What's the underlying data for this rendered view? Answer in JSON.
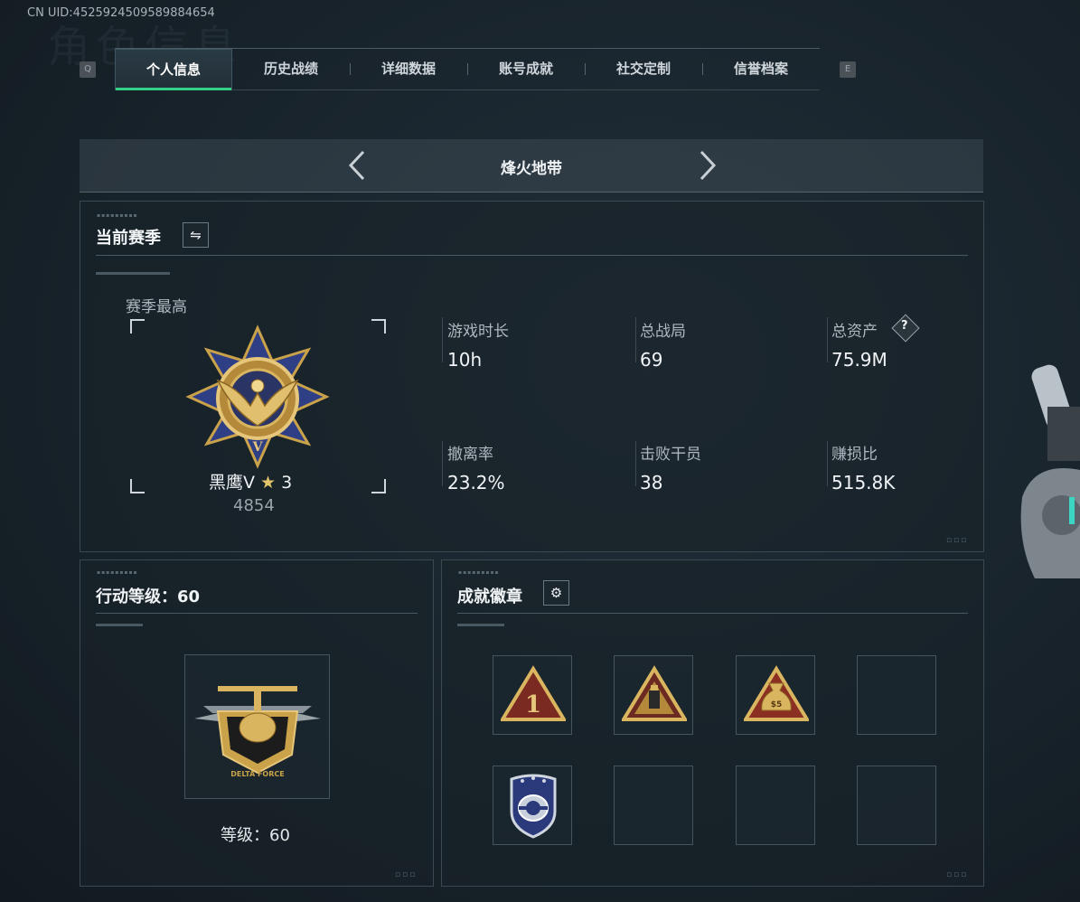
{
  "header": {
    "uid": "CN UID:4525924509589884654",
    "key_left": "Q",
    "key_right": "E"
  },
  "tabs": [
    {
      "label": "个人信息",
      "active": true
    },
    {
      "label": "历史战绩",
      "active": false
    },
    {
      "label": "详细数据",
      "active": false
    },
    {
      "label": "账号成就",
      "active": false
    },
    {
      "label": "社交定制",
      "active": false
    },
    {
      "label": "信誉档案",
      "active": false
    }
  ],
  "mode": {
    "title": "烽火地带",
    "prev_icon": "chevron-left-icon",
    "next_icon": "chevron-right-icon"
  },
  "season": {
    "title": "当前赛季",
    "switch_icon": "swap-icon",
    "best_label": "赛季最高",
    "rank_name": "黑鹰V",
    "rank_stars": "3",
    "rank_points": "4854",
    "stats": [
      {
        "label": "游戏时长",
        "value": "10h"
      },
      {
        "label": "总战局",
        "value": "69"
      },
      {
        "label": "总资产",
        "value": "75.9M",
        "help": "?"
      },
      {
        "label": "撤离率",
        "value": "23.2%"
      },
      {
        "label": "击败干员",
        "value": "38"
      },
      {
        "label": "赚损比",
        "value": "515.8K"
      }
    ]
  },
  "action_level": {
    "title": "行动等级：60",
    "level_text": "等级：60",
    "emblem_text": "DELTA FORCE"
  },
  "achievements": {
    "title": "成就徽章",
    "settings_icon": "gear-icon",
    "badges": [
      {
        "icon": "badge-first-place-icon",
        "filled": true,
        "text": "1"
      },
      {
        "icon": "badge-usb-icon",
        "filled": true,
        "text": ""
      },
      {
        "icon": "badge-money-bag-icon",
        "filled": true,
        "text": "$5"
      },
      {
        "icon": "",
        "filled": false,
        "text": ""
      },
      {
        "icon": "badge-police-shield-icon",
        "filled": true,
        "text": ""
      },
      {
        "icon": "",
        "filled": false,
        "text": ""
      },
      {
        "icon": "",
        "filled": false,
        "text": ""
      },
      {
        "icon": "",
        "filled": false,
        "text": ""
      }
    ]
  },
  "colors": {
    "accent": "#31d18a",
    "gold": "#c9a24a",
    "navy": "#2a3a7a"
  }
}
